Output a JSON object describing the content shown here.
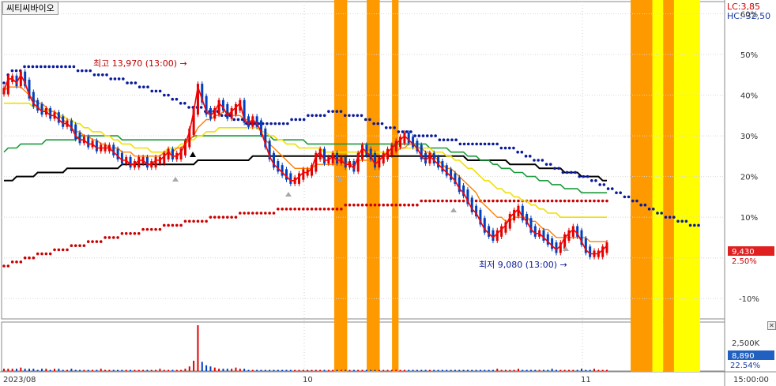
{
  "title": "씨티씨바이오",
  "legend": {
    "lc": "LC:3,85",
    "hc": "HC:-32,50"
  },
  "colors": {
    "bg": "#ffffff",
    "highlight_orange": "#ff9900",
    "highlight_yellow": "#ffff00",
    "candle_up": "#e00000",
    "candle_down": "#0040c0",
    "price_line": "#ff0000",
    "ma_short": "#ff7f00",
    "ma_mid": "#f0e000",
    "ma_long": "#1a9a3a",
    "ma_longest": "#000000",
    "envelope_upper": "#0a1a9a",
    "envelope_lower": "#cc0000",
    "last_price_bg": "#e02020",
    "last_volume_bg": "#2060c0"
  },
  "chart_data": {
    "type": "line",
    "title": "씨티씨바이오",
    "y_axis_labels": [
      "60%",
      "50%",
      "40%",
      "30%",
      "20%",
      "10%",
      "-10%"
    ],
    "y_values_pct": [
      60,
      50,
      40,
      30,
      20,
      10,
      -10
    ],
    "y_range_pct": [
      -15,
      63
    ],
    "x_axis_labels": [
      "2023/08",
      "10",
      "11",
      "15:00:00"
    ],
    "annotations": {
      "high": "최고 13,970 (13:00)",
      "low": "최저 9,080 (13:00)",
      "last_price": "9,430",
      "last_pct": "2.50%"
    },
    "volume_axis": {
      "label": "2,500K",
      "last_volume": "8,890",
      "last_pct": "22.54%"
    },
    "highlight_bands": [
      {
        "from": 46,
        "to": 47.8,
        "color": "orange"
      },
      {
        "from": 50.5,
        "to": 52.3,
        "color": "orange"
      },
      {
        "from": 54,
        "to": 54.9,
        "color": "orange"
      },
      {
        "from": 87,
        "to": 90,
        "color": "orange"
      },
      {
        "from": 90,
        "to": 91.5,
        "color": "yellow"
      },
      {
        "from": 91.5,
        "to": 93,
        "color": "orange"
      },
      {
        "from": 93,
        "to": 96.6,
        "color": "yellow"
      }
    ],
    "series": [
      {
        "key": "price",
        "values": [
          41,
          44,
          44,
          43,
          45,
          43,
          40,
          38,
          37,
          36,
          36,
          35,
          35,
          34,
          33,
          33,
          32,
          30,
          29,
          29,
          28,
          28,
          27,
          27,
          27,
          27,
          26,
          25,
          24,
          24,
          23,
          23,
          24,
          24,
          23,
          23,
          24,
          24,
          25,
          26,
          25,
          25,
          26,
          28,
          31,
          36,
          42,
          39,
          36,
          35,
          36,
          38,
          37,
          35,
          36,
          37,
          38,
          34,
          33,
          34,
          33,
          31,
          28,
          25,
          23,
          22,
          21,
          20,
          19,
          19,
          20,
          21,
          21,
          22,
          25,
          26,
          24,
          24,
          25,
          24,
          24,
          23,
          23,
          22,
          25,
          27,
          26,
          25,
          23,
          24,
          25,
          26,
          27,
          28,
          29,
          30,
          29,
          28,
          27,
          25,
          24,
          25,
          24,
          23,
          22,
          21,
          20,
          19,
          17,
          16,
          14,
          12,
          11,
          9,
          7,
          6,
          5,
          6,
          7,
          8,
          10,
          11,
          12,
          10,
          9,
          7,
          6,
          6,
          5,
          4,
          3,
          2,
          3,
          5,
          6,
          7,
          6,
          4,
          2,
          1,
          1,
          1,
          2,
          3
        ]
      },
      {
        "key": "ma_short",
        "values": [
          41,
          42,
          42,
          42,
          42,
          41,
          40,
          39,
          38,
          38,
          37,
          36,
          36,
          35,
          34,
          33,
          32,
          31,
          31,
          30,
          30,
          29,
          29,
          28,
          28,
          27,
          27,
          27,
          26,
          26,
          26,
          25,
          25,
          25,
          25,
          25,
          25,
          25,
          26,
          26,
          26,
          27,
          27,
          28,
          29,
          30,
          32,
          33,
          34,
          34,
          35,
          35,
          36,
          36,
          35,
          35,
          35,
          34,
          34,
          33,
          33,
          31,
          29,
          28,
          27,
          26,
          25,
          24,
          23,
          22,
          22,
          22,
          22,
          22,
          23,
          23,
          23,
          23,
          23,
          23,
          24,
          24,
          23,
          23,
          24,
          24,
          24,
          24,
          24,
          24,
          25,
          25,
          26,
          26,
          27,
          27,
          28,
          28,
          27,
          27,
          26,
          26,
          25,
          24,
          23,
          22,
          22,
          21,
          20,
          19,
          18,
          17,
          16,
          14,
          13,
          12,
          11,
          10,
          10,
          9,
          9,
          10,
          10,
          10,
          10,
          9,
          9,
          8,
          7,
          7,
          6,
          5,
          5,
          5,
          5,
          5,
          5,
          5,
          5,
          4,
          4,
          4,
          4,
          4
        ]
      },
      {
        "key": "ma_mid",
        "values": [
          38,
          38,
          38,
          38,
          38,
          38,
          38,
          37,
          37,
          37,
          36,
          36,
          36,
          35,
          35,
          34,
          34,
          33,
          33,
          32,
          32,
          31,
          31,
          31,
          30,
          30,
          29,
          29,
          28,
          28,
          28,
          27,
          27,
          27,
          27,
          26,
          26,
          26,
          26,
          27,
          27,
          27,
          28,
          28,
          29,
          29,
          30,
          30,
          31,
          31,
          31,
          32,
          32,
          32,
          32,
          32,
          32,
          32,
          32,
          32,
          32,
          31,
          31,
          30,
          30,
          29,
          29,
          28,
          28,
          28,
          27,
          27,
          27,
          27,
          27,
          27,
          26,
          26,
          26,
          26,
          26,
          26,
          26,
          26,
          26,
          26,
          26,
          26,
          26,
          26,
          26,
          26,
          26,
          26,
          27,
          27,
          27,
          27,
          27,
          27,
          27,
          27,
          26,
          26,
          26,
          25,
          25,
          24,
          24,
          23,
          22,
          22,
          21,
          20,
          19,
          19,
          18,
          17,
          17,
          16,
          16,
          15,
          15,
          14,
          14,
          13,
          13,
          12,
          12,
          11,
          11,
          11,
          10,
          10,
          10,
          10,
          10,
          10,
          10,
          10,
          10,
          10,
          10,
          10
        ]
      },
      {
        "key": "ma_long",
        "values": [
          26,
          27,
          27,
          27,
          28,
          28,
          28,
          28,
          28,
          28,
          29,
          29,
          29,
          29,
          29,
          29,
          29,
          29,
          30,
          30,
          30,
          30,
          30,
          30,
          30,
          30,
          30,
          30,
          29,
          29,
          29,
          29,
          29,
          29,
          29,
          29,
          29,
          29,
          29,
          29,
          29,
          29,
          29,
          29,
          29,
          30,
          30,
          30,
          30,
          30,
          30,
          30,
          30,
          30,
          30,
          30,
          30,
          30,
          30,
          30,
          30,
          30,
          30,
          30,
          29,
          29,
          29,
          29,
          29,
          29,
          29,
          29,
          28,
          28,
          28,
          28,
          28,
          28,
          28,
          28,
          28,
          28,
          28,
          28,
          28,
          28,
          28,
          28,
          28,
          28,
          28,
          28,
          28,
          28,
          28,
          28,
          28,
          28,
          28,
          28,
          28,
          27,
          27,
          27,
          27,
          27,
          26,
          26,
          26,
          26,
          25,
          25,
          25,
          24,
          24,
          24,
          23,
          23,
          22,
          22,
          22,
          21,
          21,
          21,
          20,
          20,
          20,
          19,
          19,
          19,
          18,
          18,
          18,
          17,
          17,
          17,
          17,
          16,
          16,
          16,
          16,
          16,
          16,
          16
        ]
      },
      {
        "key": "ma_longest",
        "values": [
          19,
          19,
          19,
          20,
          20,
          20,
          20,
          20,
          21,
          21,
          21,
          21,
          21,
          21,
          21,
          22,
          22,
          22,
          22,
          22,
          22,
          22,
          22,
          22,
          22,
          22,
          22,
          22,
          23,
          23,
          23,
          23,
          23,
          23,
          23,
          23,
          23,
          23,
          23,
          23,
          23,
          23,
          23,
          23,
          23,
          23,
          24,
          24,
          24,
          24,
          24,
          24,
          24,
          24,
          24,
          24,
          24,
          24,
          24,
          25,
          25,
          25,
          25,
          25,
          25,
          25,
          25,
          25,
          25,
          25,
          25,
          25,
          25,
          25,
          25,
          25,
          25,
          25,
          25,
          25,
          25,
          25,
          25,
          25,
          25,
          25,
          25,
          25,
          25,
          25,
          25,
          25,
          25,
          25,
          25,
          25,
          25,
          25,
          25,
          25,
          25,
          25,
          25,
          25,
          25,
          25,
          25,
          25,
          25,
          25,
          24,
          24,
          24,
          24,
          24,
          24,
          24,
          24,
          24,
          24,
          23,
          23,
          23,
          23,
          23,
          23,
          23,
          22,
          22,
          22,
          22,
          22,
          22,
          21,
          21,
          21,
          21,
          20,
          20,
          20,
          20,
          20,
          19,
          19
        ]
      },
      {
        "key": "envelope_upper",
        "values": [
          43,
          45,
          46,
          46,
          46,
          47,
          47,
          47,
          47,
          47,
          47,
          47,
          47,
          47,
          47,
          47,
          47,
          47,
          46,
          46,
          46,
          46,
          45,
          45,
          45,
          45,
          44,
          44,
          44,
          44,
          43,
          43,
          43,
          42,
          42,
          42,
          41,
          41,
          41,
          40,
          40,
          39,
          39,
          38,
          38,
          37,
          37,
          37,
          37,
          36,
          36,
          36,
          36,
          35,
          35,
          35,
          34,
          34,
          34,
          33,
          33,
          33,
          33,
          33,
          33,
          33,
          33,
          33,
          33,
          33,
          34,
          34,
          34,
          34,
          35,
          35,
          35,
          35,
          35,
          36,
          36,
          36,
          36,
          35,
          35,
          35,
          35,
          35,
          34,
          34,
          33,
          33,
          33,
          32,
          32,
          32,
          31,
          31,
          31,
          31,
          30,
          30,
          30,
          30,
          30,
          30,
          29,
          29,
          29,
          29,
          29,
          28,
          28,
          28,
          28,
          28,
          28,
          28,
          28,
          28,
          28,
          27,
          27,
          27,
          27,
          26,
          26,
          25,
          25,
          24,
          24,
          24,
          23,
          23,
          22,
          22,
          21,
          21,
          21,
          21,
          20,
          20,
          20,
          19,
          19,
          18,
          18,
          17,
          17,
          16,
          16,
          15,
          15,
          14,
          14,
          13,
          13,
          12,
          12,
          11,
          11,
          10,
          10,
          10,
          9,
          9,
          9,
          8,
          8,
          8
        ]
      },
      {
        "key": "envelope_lower",
        "values": [
          -2,
          -2,
          -1,
          -1,
          -1,
          0,
          0,
          0,
          1,
          1,
          1,
          1,
          2,
          2,
          2,
          2,
          3,
          3,
          3,
          3,
          4,
          4,
          4,
          4,
          5,
          5,
          5,
          5,
          6,
          6,
          6,
          6,
          6,
          7,
          7,
          7,
          7,
          7,
          8,
          8,
          8,
          8,
          8,
          9,
          9,
          9,
          9,
          9,
          9,
          10,
          10,
          10,
          10,
          10,
          10,
          10,
          11,
          11,
          11,
          11,
          11,
          11,
          11,
          11,
          11,
          12,
          12,
          12,
          12,
          12,
          12,
          12,
          12,
          12,
          12,
          12,
          12,
          12,
          12,
          12,
          12,
          13,
          13,
          13,
          13,
          13,
          13,
          13,
          13,
          13,
          13,
          13,
          13,
          13,
          13,
          13,
          13,
          13,
          13,
          14,
          14,
          14,
          14,
          14,
          14,
          14,
          14,
          14,
          14,
          14,
          14,
          14,
          14,
          14,
          14,
          14,
          14,
          14,
          14,
          14,
          14,
          14,
          14,
          14,
          14,
          14,
          14,
          14,
          14,
          14,
          14,
          14,
          14,
          14,
          14,
          14,
          14,
          14,
          14,
          14,
          14,
          14,
          14,
          14
        ]
      },
      {
        "key": "volume",
        "values": [
          2,
          2,
          2,
          2,
          3,
          2,
          2,
          2,
          1,
          2,
          2,
          1,
          2,
          2,
          1,
          1,
          2,
          1,
          1,
          1,
          1,
          1,
          1,
          2,
          1,
          1,
          1,
          1,
          1,
          1,
          1,
          1,
          1,
          1,
          1,
          1,
          1,
          2,
          1,
          1,
          1,
          1,
          1,
          2,
          4,
          9,
          40,
          8,
          5,
          4,
          3,
          2,
          2,
          2,
          2,
          3,
          2,
          2,
          1,
          1,
          1,
          1,
          1,
          1,
          1,
          1,
          1,
          1,
          1,
          1,
          1,
          1,
          1,
          1,
          1,
          1,
          1,
          1,
          1,
          1,
          1,
          1,
          1,
          1,
          1,
          1,
          1,
          1,
          1,
          1,
          1,
          1,
          1,
          1,
          1,
          1,
          1,
          1,
          1,
          1,
          1,
          1,
          1,
          1,
          1,
          1,
          1,
          1,
          1,
          1,
          1,
          1,
          1,
          1,
          1,
          1,
          1,
          2,
          1,
          1,
          1,
          1,
          2,
          1,
          1,
          1,
          1,
          1,
          1,
          1,
          2,
          1,
          1,
          1,
          1,
          1,
          1,
          2,
          1,
          1,
          2,
          1,
          1,
          1
        ]
      }
    ]
  }
}
